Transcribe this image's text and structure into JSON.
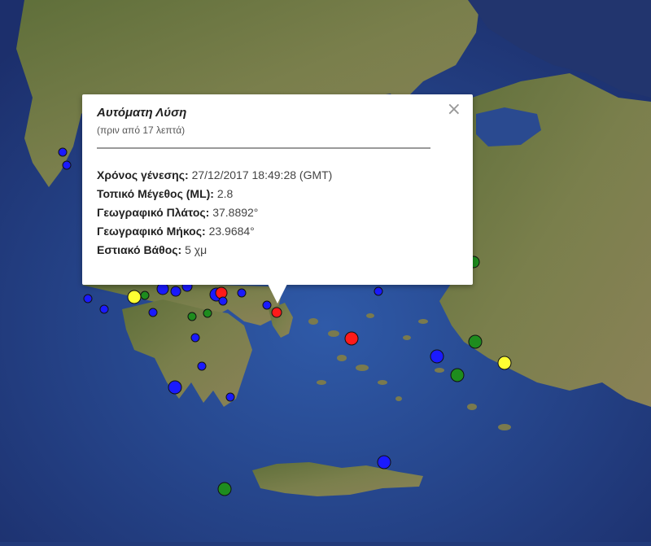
{
  "popup": {
    "title": "Αυτόματη Λύση",
    "subtitle": "(πριν από 17 λεπτά)",
    "close": "×",
    "rows": [
      {
        "key": "Χρόνος γένεσης:",
        "value": "27/12/2017  18:49:28 (GMT)"
      },
      {
        "key": "Τοπικό Μέγεθος (ML):",
        "value": "2.8"
      },
      {
        "key": "Γεωγραφικό Πλάτος:",
        "value": "37.8892°"
      },
      {
        "key": "Γεωγραφικό Μήκος:",
        "value": "23.9684°"
      },
      {
        "key": "Εστιακό Βάθος:",
        "value": "5 χμ"
      }
    ]
  },
  "colors": {
    "sea": "#2c4a96",
    "land": "#6f7a44",
    "red": "#ff1a1a",
    "blue": "#1a1aff",
    "green": "#1e8c1e",
    "yellow": "#ffff33"
  }
}
